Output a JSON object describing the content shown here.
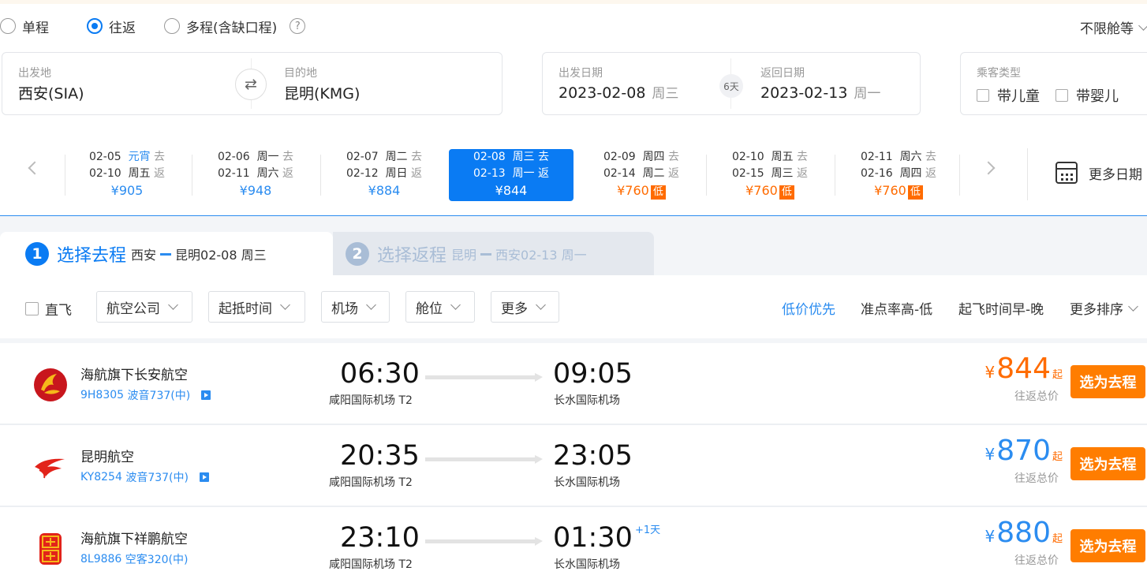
{
  "trip_types": [
    {
      "label": "单程",
      "selected": false
    },
    {
      "label": "往返",
      "selected": true
    },
    {
      "label": "多程(含缺口程)",
      "selected": false
    }
  ],
  "help_icon": "?",
  "cabin_class": "不限舱等",
  "origin": {
    "label": "出发地",
    "value": "西安(SIA)"
  },
  "destination": {
    "label": "目的地",
    "value": "昆明(KMG)"
  },
  "swap_icon": "⇄",
  "depart_date": {
    "label": "出发日期",
    "date": "2023-02-08",
    "weekday": "周三"
  },
  "return_date": {
    "label": "返回日期",
    "date": "2023-02-13",
    "weekday": "周一"
  },
  "trip_days": "6天",
  "passenger": {
    "label": "乘客类型",
    "child": "带儿童",
    "infant": "带婴儿"
  },
  "date_options": [
    {
      "go_date": "02-05",
      "go_day": "元宵",
      "go_suffix": "去",
      "ret_date": "02-10",
      "ret_day": "周五",
      "ret_suffix": "返",
      "price": "¥905",
      "holiday": true,
      "low": false,
      "low_tag": ""
    },
    {
      "go_date": "02-06",
      "go_day": "周一",
      "go_suffix": "去",
      "ret_date": "02-11",
      "ret_day": "周六",
      "ret_suffix": "返",
      "price": "¥948",
      "holiday": false,
      "low": false,
      "low_tag": ""
    },
    {
      "go_date": "02-07",
      "go_day": "周二",
      "go_suffix": "去",
      "ret_date": "02-12",
      "ret_day": "周日",
      "ret_suffix": "返",
      "price": "¥884",
      "holiday": false,
      "low": false,
      "low_tag": ""
    },
    {
      "go_date": "02-08",
      "go_day": "周三",
      "go_suffix": "去",
      "ret_date": "02-13",
      "ret_day": "周一",
      "ret_suffix": "返",
      "price": "¥844",
      "holiday": false,
      "low": false,
      "low_tag": "",
      "selected": true
    },
    {
      "go_date": "02-09",
      "go_day": "周四",
      "go_suffix": "去",
      "ret_date": "02-14",
      "ret_day": "周二",
      "ret_suffix": "返",
      "price": "¥760",
      "holiday": false,
      "low": true,
      "low_tag": "低"
    },
    {
      "go_date": "02-10",
      "go_day": "周五",
      "go_suffix": "去",
      "ret_date": "02-15",
      "ret_day": "周三",
      "ret_suffix": "返",
      "price": "¥760",
      "holiday": false,
      "low": true,
      "low_tag": "低"
    },
    {
      "go_date": "02-11",
      "go_day": "周六",
      "go_suffix": "去",
      "ret_date": "02-16",
      "ret_day": "周四",
      "ret_suffix": "返",
      "price": "¥760",
      "holiday": false,
      "low": true,
      "low_tag": "低"
    }
  ],
  "more_dates": "更多日期",
  "steps": [
    {
      "num": "1",
      "title": "选择去程",
      "from": "西安",
      "to": "昆明",
      "date": "02-08 周三",
      "active": true
    },
    {
      "num": "2",
      "title": "选择返程",
      "from": "昆明",
      "to": "西安",
      "date": "02-13 周一",
      "active": false
    }
  ],
  "filters": {
    "direct": "直飞",
    "buttons": [
      "航空公司",
      "起抵时间",
      "机场",
      "舱位",
      "更多"
    ]
  },
  "sorts": [
    {
      "label": "低价优先",
      "active": true
    },
    {
      "label": "准点率高-低",
      "active": false
    },
    {
      "label": "起飞时间早-晚",
      "active": false
    },
    {
      "label": "更多排序",
      "active": false
    }
  ],
  "flights": [
    {
      "airline": "海航旗下长安航空",
      "flight_no": "9H8305",
      "aircraft": "波音737(中)",
      "dep_time": "06:30",
      "arr_time": "09:05",
      "dep_airport": "咸阳国际机场",
      "dep_terminal": "T2",
      "arr_airport": "长水国际机场",
      "day_offset": "",
      "price_symbol": "¥",
      "price": "844",
      "price_suffix": "起",
      "price_color": "#ff6b00",
      "price_note": "往返总价",
      "button": "选为去程",
      "logo": "changan-logo"
    },
    {
      "airline": "昆明航空",
      "flight_no": "KY8254",
      "aircraft": "波音737(中)",
      "dep_time": "20:35",
      "arr_time": "23:05",
      "dep_airport": "咸阳国际机场",
      "dep_terminal": "T2",
      "arr_airport": "长水国际机场",
      "day_offset": "",
      "price_symbol": "¥",
      "price": "870",
      "price_suffix": "起",
      "price_color": "#2b8cf0",
      "price_note": "往返总价",
      "button": "选为去程",
      "logo": "kunming-logo"
    },
    {
      "airline": "海航旗下祥鹏航空",
      "flight_no": "8L9886",
      "aircraft": "空客320(中)",
      "dep_time": "23:10",
      "arr_time": "01:30",
      "dep_airport": "咸阳国际机场",
      "dep_terminal": "T2",
      "arr_airport": "长水国际机场",
      "day_offset": "+1天",
      "price_symbol": "¥",
      "price": "880",
      "price_suffix": "起",
      "price_color": "#2b8cf0",
      "price_note": "往返总价",
      "button": "选为去程",
      "logo": "luckyair-logo"
    }
  ],
  "colors": {
    "primary": "#0a7bf3",
    "link": "#2b8cf0",
    "orange": "#ff6b00",
    "button": "#ff7d00"
  }
}
